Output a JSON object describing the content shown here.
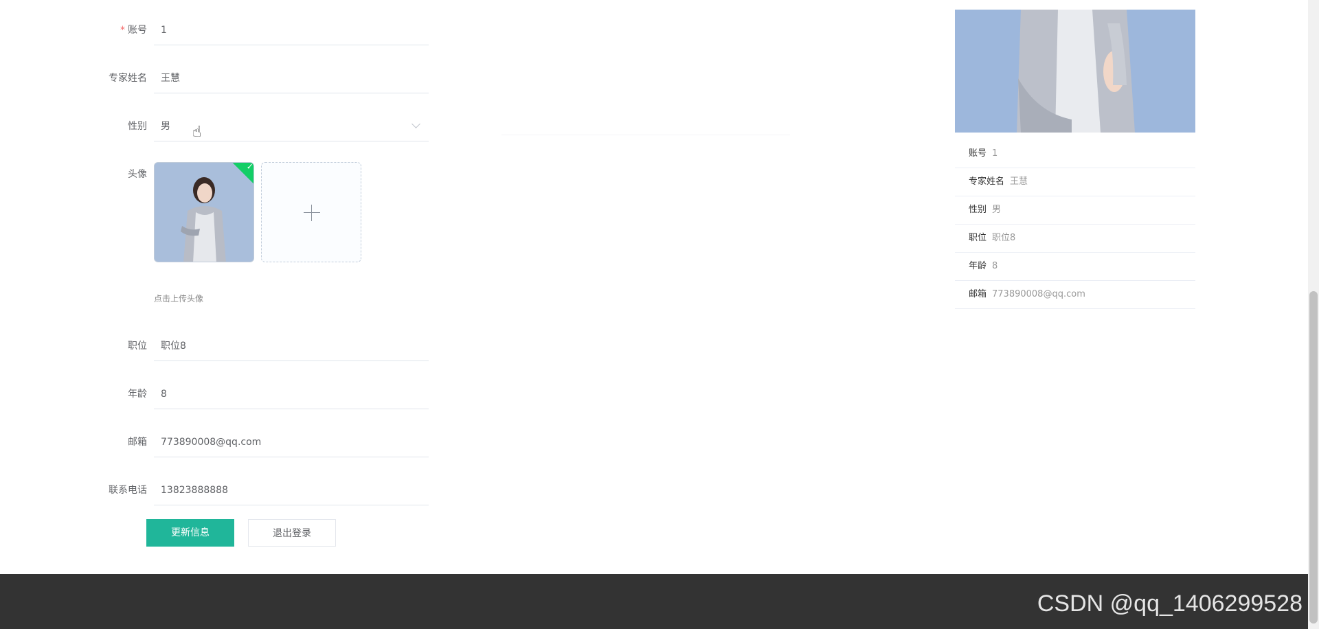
{
  "form": {
    "account": {
      "label": "账号",
      "value": "1",
      "required_mark": "*"
    },
    "expert_name": {
      "label": "专家姓名",
      "value": "王慧"
    },
    "gender": {
      "label": "性别",
      "value": "男"
    },
    "avatar": {
      "label": "头像",
      "upload_tip": "点击上传头像"
    },
    "position": {
      "label": "职位",
      "value": "职位8"
    },
    "age": {
      "label": "年龄",
      "value": "8"
    },
    "email": {
      "label": "邮箱",
      "value": "773890008@qq.com"
    },
    "phone": {
      "label": "联系电话",
      "value": "13823888888"
    },
    "update_button": "更新信息",
    "logout_button": "退出登录"
  },
  "info_panel": {
    "rows": [
      {
        "key": "账号",
        "value": "1"
      },
      {
        "key": "专家姓名",
        "value": "王慧"
      },
      {
        "key": "性别",
        "value": "男"
      },
      {
        "key": "职位",
        "value": "职位8"
      },
      {
        "key": "年龄",
        "value": "8"
      },
      {
        "key": "邮箱",
        "value": "773890008@qq.com"
      }
    ]
  },
  "footer": {
    "watermark": "CSDN @qq_1406299528"
  },
  "colors": {
    "primary": "#20b69a",
    "footer_bg": "#333333",
    "success_badge": "#13ce66"
  }
}
